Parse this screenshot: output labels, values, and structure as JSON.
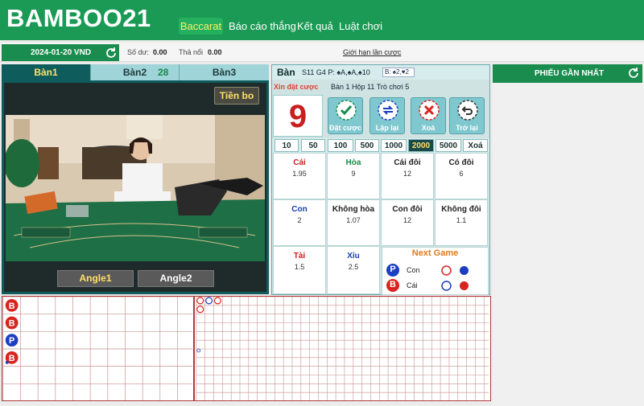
{
  "header": {
    "logo": "BAMBOO21",
    "nav": [
      "Baccarat",
      "Báo cáo thắng",
      "Kết quả",
      "Luật chơi"
    ]
  },
  "infobar": {
    "date": "2024-01-20 VND",
    "balance_label": "Số dư:",
    "balance_value": "0.00",
    "release_label": "Thả nổi",
    "release_value": "0.00",
    "limits_link": "Giới hạn lần cược"
  },
  "video": {
    "tabs": [
      "Bàn1",
      "Bàn2",
      "Bàn3"
    ],
    "tab_count": "28",
    "tip_button": "Tiền bo",
    "angle_buttons": [
      "Angle1",
      "Angle2"
    ]
  },
  "betting": {
    "table_label": "Bàn",
    "table_info": "S11 G4 P: ♠A,♠A,♠10",
    "mini_info": "B: ♠2,♥2",
    "prompt": "Xin đặt cược",
    "round_info": "Bàn 1  Hộp 11  Trò chơi 5",
    "countdown": "9",
    "actions": [
      "Đặt cược",
      "Lặp lại",
      "Xoá",
      "Trở lại"
    ],
    "chips": [
      "10",
      "50",
      "100",
      "500",
      "1000",
      "2000",
      "5000",
      "Xoá"
    ],
    "selected_chip": "2000",
    "bets": [
      {
        "name": "Cái",
        "odds": "1.95"
      },
      {
        "name": "Hòa",
        "odds": "9"
      },
      {
        "name": "Cái đôi",
        "odds": "12"
      },
      {
        "name": "Có đôi",
        "odds": "6"
      },
      {
        "name": "Con",
        "odds": "2"
      },
      {
        "name": "Không hòa",
        "odds": "1.07"
      },
      {
        "name": "Con đôi",
        "odds": "12"
      },
      {
        "name": "Không đôi",
        "odds": "1.1"
      },
      {
        "name": "Tài",
        "odds": "1.5"
      },
      {
        "name": "Xỉu",
        "odds": "2.5"
      }
    ],
    "next_game": {
      "title": "Next Game",
      "rows": [
        {
          "badge": "P",
          "label": "Con"
        },
        {
          "badge": "B",
          "label": "Cái"
        }
      ]
    }
  },
  "right_panel": {
    "title": "PHIẾU GẦN NHẤT"
  },
  "roads": {
    "bead_road": [
      "B",
      "B",
      "P",
      "B"
    ]
  },
  "colors": {
    "brand_green": "#1a9a55",
    "banker_red": "#d9231e",
    "player_blue": "#1c3ec0",
    "road_border": "#b03a3a"
  }
}
